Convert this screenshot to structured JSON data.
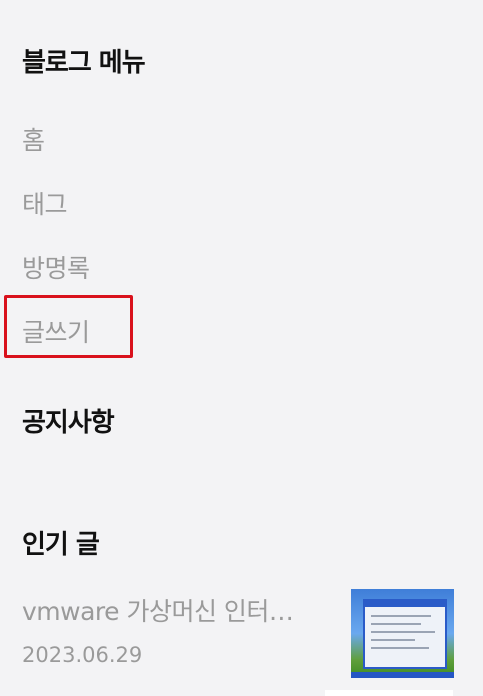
{
  "blog_menu": {
    "title": "블로그 메뉴",
    "items": [
      {
        "label": "홈"
      },
      {
        "label": "태그"
      },
      {
        "label": "방명록"
      },
      {
        "label": "글쓰기"
      }
    ]
  },
  "notice": {
    "title": "공지사항"
  },
  "popular": {
    "title": "인기 글",
    "posts": [
      {
        "title": "vmware 가상머신 인터…",
        "date": "2023.06.29"
      }
    ]
  },
  "colors": {
    "background": "#f3f3f5",
    "title_text": "#111111",
    "menu_text": "#9a9a9a",
    "highlight": "#d9111c"
  }
}
